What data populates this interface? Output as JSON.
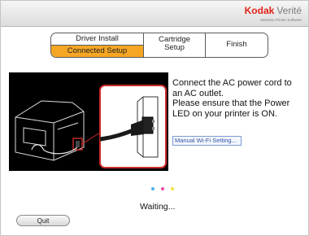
{
  "brand": {
    "name": "Kodak",
    "product": "Verité",
    "tagline": "Wireless Printer Software",
    "accent_color": "#e2231a"
  },
  "steps": {
    "driver_install": "Driver Install",
    "connected_setup": "Connected Setup",
    "cartridge_setup_line1": "Cartridge",
    "cartridge_setup_line2": "Setup",
    "finish": "Finish",
    "active": "Connected Setup",
    "active_color": "#f5a623"
  },
  "instructions": {
    "line1": "Connect the AC power cord to an AC outlet.",
    "line2": "Please ensure that the Power LED on your printer is ON."
  },
  "wifi_link": "Manual Wi-Fi Setting...",
  "progress": {
    "dot_colors": [
      "#4ab3e8",
      "#e84aa6",
      "#f2e23a"
    ]
  },
  "status": "Waiting...",
  "quit_label": "Quit"
}
